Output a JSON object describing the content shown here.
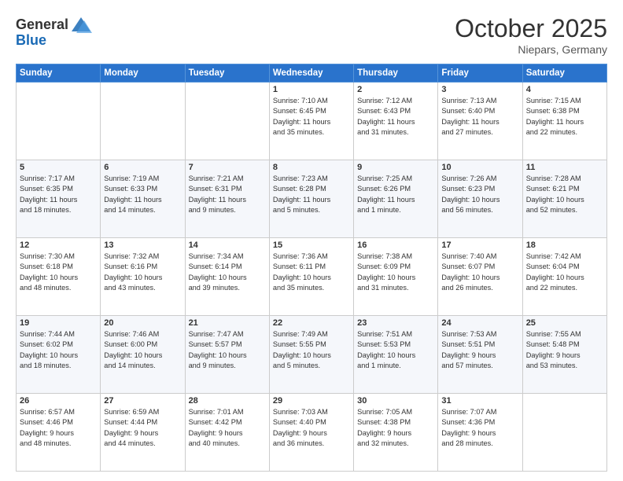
{
  "header": {
    "logo_general": "General",
    "logo_blue": "Blue",
    "month": "October 2025",
    "location": "Niepars, Germany"
  },
  "weekdays": [
    "Sunday",
    "Monday",
    "Tuesday",
    "Wednesday",
    "Thursday",
    "Friday",
    "Saturday"
  ],
  "weeks": [
    [
      {
        "day": "",
        "info": ""
      },
      {
        "day": "",
        "info": ""
      },
      {
        "day": "",
        "info": ""
      },
      {
        "day": "1",
        "info": "Sunrise: 7:10 AM\nSunset: 6:45 PM\nDaylight: 11 hours\nand 35 minutes."
      },
      {
        "day": "2",
        "info": "Sunrise: 7:12 AM\nSunset: 6:43 PM\nDaylight: 11 hours\nand 31 minutes."
      },
      {
        "day": "3",
        "info": "Sunrise: 7:13 AM\nSunset: 6:40 PM\nDaylight: 11 hours\nand 27 minutes."
      },
      {
        "day": "4",
        "info": "Sunrise: 7:15 AM\nSunset: 6:38 PM\nDaylight: 11 hours\nand 22 minutes."
      }
    ],
    [
      {
        "day": "5",
        "info": "Sunrise: 7:17 AM\nSunset: 6:35 PM\nDaylight: 11 hours\nand 18 minutes."
      },
      {
        "day": "6",
        "info": "Sunrise: 7:19 AM\nSunset: 6:33 PM\nDaylight: 11 hours\nand 14 minutes."
      },
      {
        "day": "7",
        "info": "Sunrise: 7:21 AM\nSunset: 6:31 PM\nDaylight: 11 hours\nand 9 minutes."
      },
      {
        "day": "8",
        "info": "Sunrise: 7:23 AM\nSunset: 6:28 PM\nDaylight: 11 hours\nand 5 minutes."
      },
      {
        "day": "9",
        "info": "Sunrise: 7:25 AM\nSunset: 6:26 PM\nDaylight: 11 hours\nand 1 minute."
      },
      {
        "day": "10",
        "info": "Sunrise: 7:26 AM\nSunset: 6:23 PM\nDaylight: 10 hours\nand 56 minutes."
      },
      {
        "day": "11",
        "info": "Sunrise: 7:28 AM\nSunset: 6:21 PM\nDaylight: 10 hours\nand 52 minutes."
      }
    ],
    [
      {
        "day": "12",
        "info": "Sunrise: 7:30 AM\nSunset: 6:18 PM\nDaylight: 10 hours\nand 48 minutes."
      },
      {
        "day": "13",
        "info": "Sunrise: 7:32 AM\nSunset: 6:16 PM\nDaylight: 10 hours\nand 43 minutes."
      },
      {
        "day": "14",
        "info": "Sunrise: 7:34 AM\nSunset: 6:14 PM\nDaylight: 10 hours\nand 39 minutes."
      },
      {
        "day": "15",
        "info": "Sunrise: 7:36 AM\nSunset: 6:11 PM\nDaylight: 10 hours\nand 35 minutes."
      },
      {
        "day": "16",
        "info": "Sunrise: 7:38 AM\nSunset: 6:09 PM\nDaylight: 10 hours\nand 31 minutes."
      },
      {
        "day": "17",
        "info": "Sunrise: 7:40 AM\nSunset: 6:07 PM\nDaylight: 10 hours\nand 26 minutes."
      },
      {
        "day": "18",
        "info": "Sunrise: 7:42 AM\nSunset: 6:04 PM\nDaylight: 10 hours\nand 22 minutes."
      }
    ],
    [
      {
        "day": "19",
        "info": "Sunrise: 7:44 AM\nSunset: 6:02 PM\nDaylight: 10 hours\nand 18 minutes."
      },
      {
        "day": "20",
        "info": "Sunrise: 7:46 AM\nSunset: 6:00 PM\nDaylight: 10 hours\nand 14 minutes."
      },
      {
        "day": "21",
        "info": "Sunrise: 7:47 AM\nSunset: 5:57 PM\nDaylight: 10 hours\nand 9 minutes."
      },
      {
        "day": "22",
        "info": "Sunrise: 7:49 AM\nSunset: 5:55 PM\nDaylight: 10 hours\nand 5 minutes."
      },
      {
        "day": "23",
        "info": "Sunrise: 7:51 AM\nSunset: 5:53 PM\nDaylight: 10 hours\nand 1 minute."
      },
      {
        "day": "24",
        "info": "Sunrise: 7:53 AM\nSunset: 5:51 PM\nDaylight: 9 hours\nand 57 minutes."
      },
      {
        "day": "25",
        "info": "Sunrise: 7:55 AM\nSunset: 5:48 PM\nDaylight: 9 hours\nand 53 minutes."
      }
    ],
    [
      {
        "day": "26",
        "info": "Sunrise: 6:57 AM\nSunset: 4:46 PM\nDaylight: 9 hours\nand 48 minutes."
      },
      {
        "day": "27",
        "info": "Sunrise: 6:59 AM\nSunset: 4:44 PM\nDaylight: 9 hours\nand 44 minutes."
      },
      {
        "day": "28",
        "info": "Sunrise: 7:01 AM\nSunset: 4:42 PM\nDaylight: 9 hours\nand 40 minutes."
      },
      {
        "day": "29",
        "info": "Sunrise: 7:03 AM\nSunset: 4:40 PM\nDaylight: 9 hours\nand 36 minutes."
      },
      {
        "day": "30",
        "info": "Sunrise: 7:05 AM\nSunset: 4:38 PM\nDaylight: 9 hours\nand 32 minutes."
      },
      {
        "day": "31",
        "info": "Sunrise: 7:07 AM\nSunset: 4:36 PM\nDaylight: 9 hours\nand 28 minutes."
      },
      {
        "day": "",
        "info": ""
      }
    ]
  ]
}
